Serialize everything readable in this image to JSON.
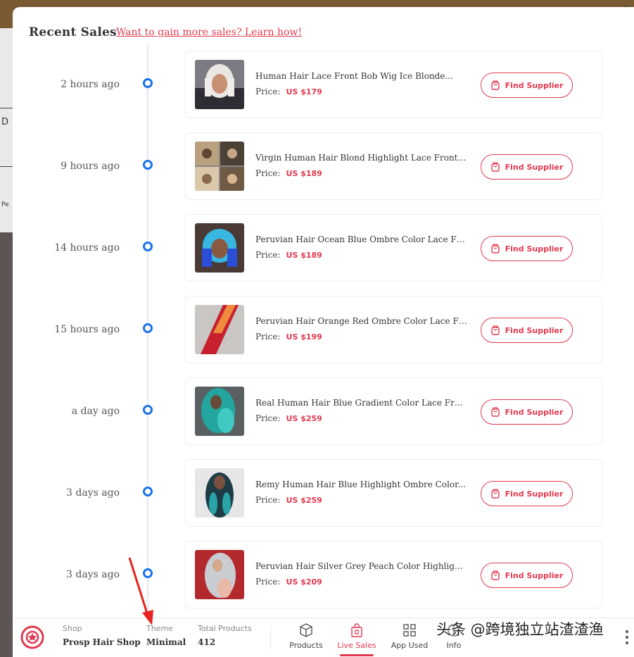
{
  "header": {
    "title": "Recent Sales",
    "learn_link": "Want to gain more sales? Learn how!"
  },
  "background": {
    "left_fragment_1": "D",
    "left_fragment_2": "Pe"
  },
  "sales": [
    {
      "time": "2 hours ago",
      "title": "Human Hair Lace Front Bob Wig Ice Blonde...",
      "price_label": "Price:",
      "price": "US $179",
      "button": "Find Supplier"
    },
    {
      "time": "9 hours ago",
      "title": "Virgin Human Hair Blond Highlight Lace Front Bo...",
      "price_label": "Price:",
      "price": "US $189",
      "button": "Find Supplier"
    },
    {
      "time": "14 hours ago",
      "title": "Peruvian Hair Ocean Blue Ombre Color Lace Fro...",
      "price_label": "Price:",
      "price": "US $189",
      "button": "Find Supplier"
    },
    {
      "time": "15 hours ago",
      "title": "Peruvian Hair Orange Red Ombre Color Lace Fro...",
      "price_label": "Price:",
      "price": "US $199",
      "button": "Find Supplier"
    },
    {
      "time": "a day ago",
      "title": "Real Human Hair Blue Gradient Color Lace Front...",
      "price_label": "Price:",
      "price": "US $259",
      "button": "Find Supplier"
    },
    {
      "time": "3 days ago",
      "title": "Remy Human Hair Blue Highlight Ombre Color...",
      "price_label": "Price:",
      "price": "US $259",
      "button": "Find Supplier"
    },
    {
      "time": "3 days ago",
      "title": "Peruvian Hair Silver Grey Peach Color Highlight...",
      "price_label": "Price:",
      "price": "US $209",
      "button": "Find Supplier"
    }
  ],
  "bottom_bar": {
    "shop_label": "Shop",
    "shop_value": "Prosp Hair Shop",
    "theme_label": "Theme",
    "theme_value": "Minimal",
    "products_label": "Total Products",
    "products_value": "412",
    "tabs": [
      {
        "label": "Products",
        "icon": "cube-icon"
      },
      {
        "label": "Live Sales",
        "icon": "shopping-bag-icon"
      },
      {
        "label": "App Used",
        "icon": "grid-icon"
      },
      {
        "label": "Info",
        "icon": "info-icon"
      }
    ]
  },
  "watermark": "头条 @跨境独立站渣渣渔",
  "colors": {
    "accent": "#e03a50",
    "timeline_dot": "#1a73e8"
  }
}
